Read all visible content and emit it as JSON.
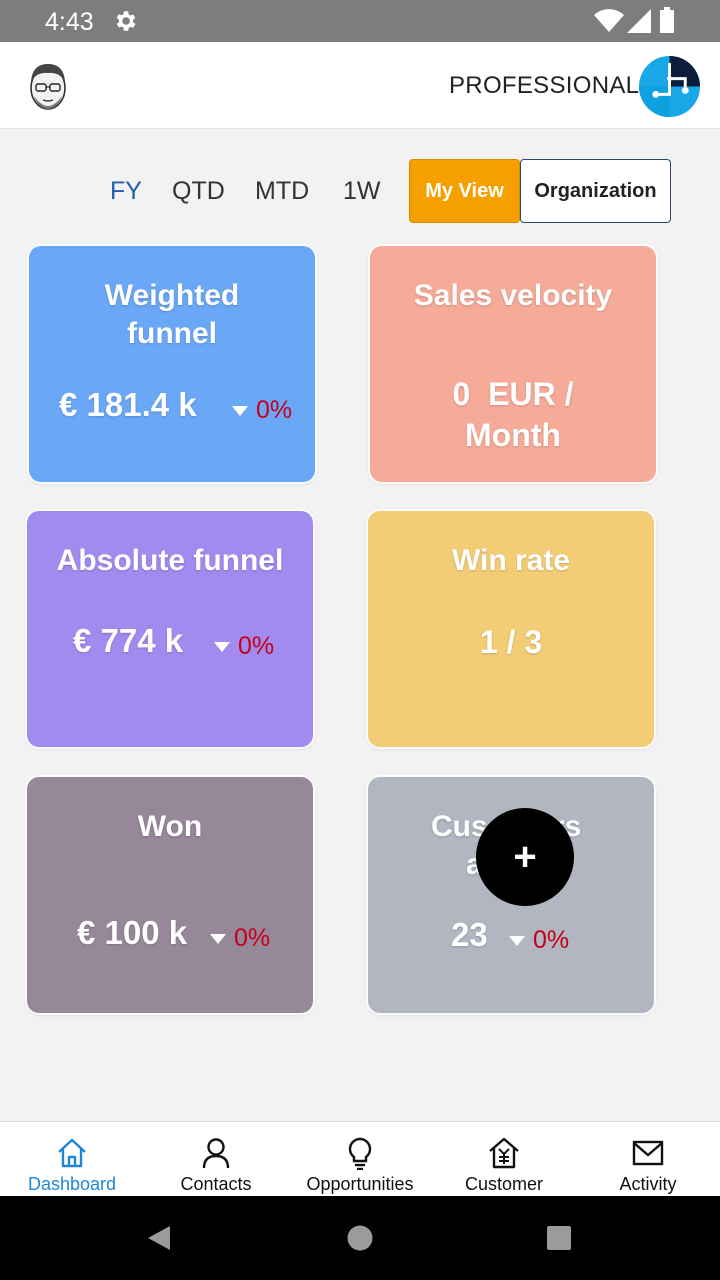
{
  "status_bar": {
    "time": "4:43",
    "icons": [
      "gear-icon",
      "wifi-icon",
      "signal-icon",
      "battery-icon"
    ]
  },
  "header": {
    "plan_label": "PROFESSIONAL"
  },
  "filters": {
    "periods": [
      "FY",
      "QTD",
      "MTD",
      "1W"
    ],
    "active_period": "FY",
    "my_view_label": "My View",
    "organization_label": "Organization"
  },
  "cards": {
    "weighted_funnel": {
      "title_line1": "Weighted",
      "title_line2": "funnel",
      "value": "€ 181.4 k",
      "delta": "0%",
      "color": "#6aa7f6"
    },
    "sales_velocity": {
      "title": "Sales velocity",
      "value_line1": "0  EUR /",
      "value_line2": "Month",
      "color": "#f6ab99"
    },
    "absolute_funnel": {
      "title": "Absolute funnel",
      "value": "€ 774 k",
      "delta": "0%",
      "color": "#a18bee"
    },
    "win_rate": {
      "title": "Win rate",
      "value": "1 / 3",
      "color": "#f3cd76"
    },
    "won": {
      "title": "Won",
      "value": "€ 100 k",
      "delta": "0%",
      "color": "#968899"
    },
    "customers": {
      "title_left": "Cus",
      "title_right": "rs",
      "title_line2": "a",
      "value": "23",
      "delta": "0%",
      "color": "#b1b6c0"
    }
  },
  "fab": {
    "label": "+"
  },
  "bottom_nav": {
    "items": [
      {
        "label": "Dashboard",
        "icon": "home-icon"
      },
      {
        "label": "Contacts",
        "icon": "person-icon"
      },
      {
        "label": "Opportunities",
        "icon": "lightbulb-icon"
      },
      {
        "label": "Customer",
        "icon": "customer-icon"
      },
      {
        "label": "Activity",
        "icon": "mail-icon"
      }
    ],
    "active_index": 0,
    "active_color": "#1e88d6"
  },
  "colors": {
    "accent_orange": "#f6a000",
    "delta_red": "#c4001a",
    "period_active": "#1f5fb0"
  }
}
